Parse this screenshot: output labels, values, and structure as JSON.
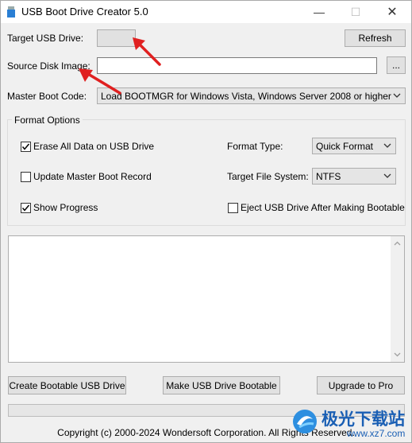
{
  "window": {
    "title": "USB Boot Drive Creator 5.0",
    "minimize_glyph": "—",
    "maximize_glyph": "☐",
    "close_glyph": "✕"
  },
  "form": {
    "target_usb_label": "Target USB Drive:",
    "target_usb_value": "",
    "refresh_label": "Refresh",
    "source_image_label": "Source Disk Image:",
    "source_image_value": "",
    "browse_label": "...",
    "mbr_label": "Master Boot Code:",
    "mbr_value": "Load BOOTMGR for Windows Vista, Windows Server 2008 or higher"
  },
  "format_options": {
    "group_title": "Format Options",
    "erase_label": "Erase All Data on USB Drive",
    "erase_checked": true,
    "update_mbr_label": "Update Master Boot Record",
    "update_mbr_checked": false,
    "show_progress_label": "Show Progress",
    "show_progress_checked": true,
    "eject_label": "Eject USB Drive After Making Bootable",
    "eject_checked": false,
    "format_type_label": "Format Type:",
    "format_type_value": "Quick Format",
    "fs_label": "Target File System:",
    "fs_value": "NTFS"
  },
  "log": {
    "text": ""
  },
  "actions": {
    "create_label": "Create Bootable USB Drive",
    "make_label": "Make USB Drive Bootable",
    "upgrade_label": "Upgrade to Pro"
  },
  "progress": {
    "percent": 0
  },
  "footer": {
    "copyright": "Copyright (c) 2000-2024 Wondersoft Corporation. All Rights Reserved."
  },
  "watermark": {
    "text": "极光下载站",
    "domain": "www.xz7.com"
  },
  "colors": {
    "annotation_arrow": "#e02020",
    "progress_fill": "#06b025"
  }
}
